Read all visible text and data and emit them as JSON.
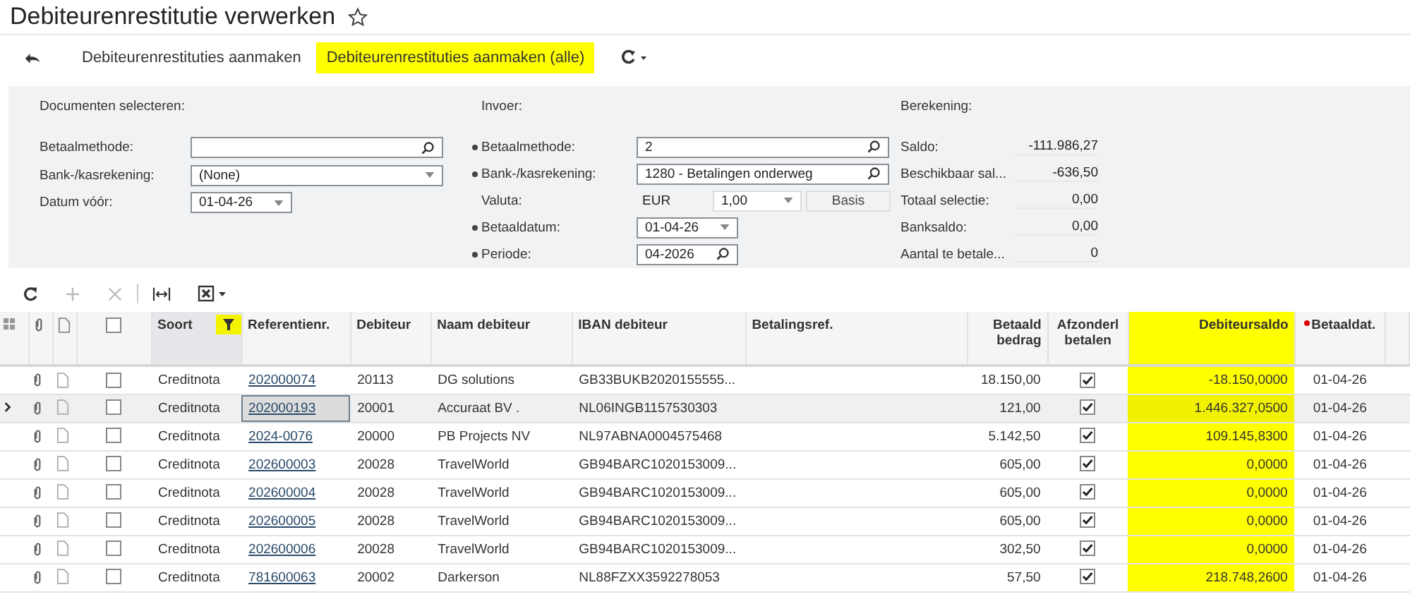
{
  "title": "Debiteurenrestitutie verwerken",
  "favorite": false,
  "actions": [
    {
      "label": "Debiteurenrestituties aanmaken",
      "highlighted": false
    },
    {
      "label": "Debiteurenrestituties aanmaken (alle)",
      "highlighted": true
    }
  ],
  "form": {
    "sections": [
      {
        "heading": "Documenten selecteren:",
        "fields": [
          {
            "label": "Betaalmethode:",
            "required": false,
            "kind": "lookup"
          },
          {
            "label": "Bank-/kasrekening:",
            "required": false,
            "value": "(None)",
            "kind": "select"
          },
          {
            "label": "Datum vóór:",
            "required": false,
            "value": "01-04-26",
            "kind": "date"
          }
        ]
      },
      {
        "heading": "Invoer:",
        "fields": [
          {
            "label": "Betaalmethode:",
            "required": true,
            "value": "2",
            "kind": "lookup"
          },
          {
            "label": "Bank-/kasrekening:",
            "required": true,
            "value": "1280 - Betalingen onderweg",
            "kind": "lookup"
          },
          {
            "label": "Valuta:",
            "required": false,
            "value": "EUR",
            "kind": "currency",
            "rate": "1,00",
            "button": "Basis"
          },
          {
            "label": "Betaaldatum:",
            "required": true,
            "value": "01-04-26",
            "kind": "date"
          },
          {
            "label": "Periode:",
            "required": true,
            "value": "04-2026",
            "kind": "period"
          }
        ]
      }
    ],
    "summary": {
      "heading": "Berekening:",
      "items": [
        {
          "label": "Saldo:",
          "value": "-111.986,27"
        },
        {
          "label": "Beschikbaar sal...",
          "value": "-636,50"
        },
        {
          "label": "Totaal selectie:",
          "value": "0,00"
        },
        {
          "label": "Banksaldo:",
          "value": "0,00"
        },
        {
          "label": "Aantal te betale...",
          "value": "0"
        }
      ]
    }
  },
  "table": {
    "all_checked": false,
    "columns": [
      {
        "label": "Soort",
        "filtered": true,
        "highlighted": false,
        "required": false
      },
      {
        "label": "Referentienr.",
        "filtered": false,
        "highlighted": false,
        "required": false
      },
      {
        "label": "Debiteur",
        "filtered": false,
        "highlighted": false,
        "required": false
      },
      {
        "label": "Naam debiteur",
        "filtered": false,
        "highlighted": false,
        "required": false
      },
      {
        "label": "IBAN debiteur",
        "filtered": false,
        "highlighted": false,
        "required": false
      },
      {
        "label": "Betalingsref.",
        "filtered": false,
        "highlighted": false,
        "required": false
      },
      {
        "label": "Betaald bedrag",
        "filtered": false,
        "highlighted": false,
        "required": false
      },
      {
        "label": "Afzonderl betalen",
        "filtered": false,
        "highlighted": false,
        "required": false
      },
      {
        "label": "Debiteursaldo",
        "filtered": false,
        "highlighted": true,
        "required": false
      },
      {
        "label": "Betaaldat.",
        "filtered": false,
        "highlighted": false,
        "required": true
      }
    ],
    "rows": [
      {
        "selected": false,
        "checked": false,
        "soort": "Creditnota",
        "ref": "202000074",
        "debiteur": "20113",
        "naam": "DG solutions",
        "iban": "GB33BUKB2020155555...",
        "bedrag": "18.150,00",
        "afzonderlijk": true,
        "saldo": "-18.150,0000",
        "datum": "01-04-26"
      },
      {
        "selected": true,
        "checked": false,
        "soort": "Creditnota",
        "ref": "202000193",
        "debiteur": "20001",
        "naam": "Accuraat BV .",
        "iban": "NL06INGB1157530303",
        "bedrag": "121,00",
        "afzonderlijk": true,
        "saldo": "1.446.327,0500",
        "datum": "01-04-26"
      },
      {
        "selected": false,
        "checked": false,
        "soort": "Creditnota",
        "ref": "2024-0076",
        "debiteur": "20000",
        "naam": "PB Projects NV",
        "iban": "NL97ABNA0004575468",
        "bedrag": "5.142,50",
        "afzonderlijk": true,
        "saldo": "109.145,8300",
        "datum": "01-04-26"
      },
      {
        "selected": false,
        "checked": false,
        "soort": "Creditnota",
        "ref": "202600003",
        "debiteur": "20028",
        "naam": "TravelWorld",
        "iban": "GB94BARC1020153009...",
        "bedrag": "605,00",
        "afzonderlijk": true,
        "saldo": "0,0000",
        "datum": "01-04-26"
      },
      {
        "selected": false,
        "checked": false,
        "soort": "Creditnota",
        "ref": "202600004",
        "debiteur": "20028",
        "naam": "TravelWorld",
        "iban": "GB94BARC1020153009...",
        "bedrag": "605,00",
        "afzonderlijk": true,
        "saldo": "0,0000",
        "datum": "01-04-26"
      },
      {
        "selected": false,
        "checked": false,
        "soort": "Creditnota",
        "ref": "202600005",
        "debiteur": "20028",
        "naam": "TravelWorld",
        "iban": "GB94BARC1020153009...",
        "bedrag": "605,00",
        "afzonderlijk": true,
        "saldo": "0,0000",
        "datum": "01-04-26"
      },
      {
        "selected": false,
        "checked": false,
        "soort": "Creditnota",
        "ref": "202600006",
        "debiteur": "20028",
        "naam": "TravelWorld",
        "iban": "GB94BARC1020153009...",
        "bedrag": "302,50",
        "afzonderlijk": true,
        "saldo": "0,0000",
        "datum": "01-04-26"
      },
      {
        "selected": false,
        "checked": false,
        "soort": "Creditnota",
        "ref": "781600063",
        "debiteur": "20002",
        "naam": "Darkerson",
        "iban": "NL88FZXX3592278053",
        "bedrag": "57,50",
        "afzonderlijk": true,
        "saldo": "218.748,2600",
        "datum": "01-04-26"
      }
    ]
  }
}
